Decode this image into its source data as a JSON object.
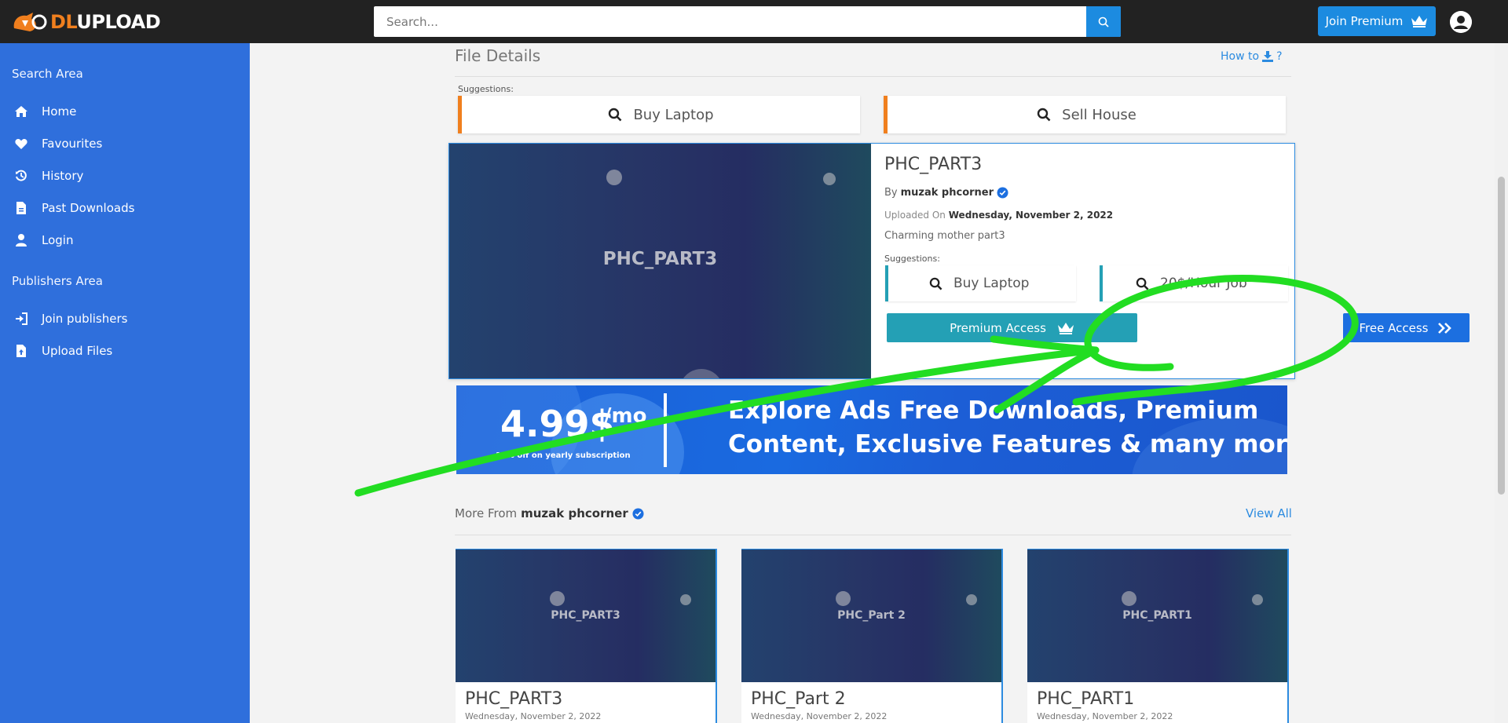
{
  "header": {
    "logo_dl": "DL",
    "logo_upload": "UPLOAD",
    "search_placeholder": "Search...",
    "join_premium_label": "Join Premium"
  },
  "sidebar": {
    "search_area_label": "Search Area",
    "search_items": [
      {
        "label": "Home",
        "icon": "home-icon"
      },
      {
        "label": "Favourites",
        "icon": "heart-icon"
      },
      {
        "label": "History",
        "icon": "history-icon"
      },
      {
        "label": "Past Downloads",
        "icon": "file-icon"
      },
      {
        "label": "Login",
        "icon": "user-icon"
      }
    ],
    "publishers_area_label": "Publishers Area",
    "publisher_items": [
      {
        "label": "Join publishers",
        "icon": "sign-in-icon"
      },
      {
        "label": "Upload Files",
        "icon": "file-upload-icon"
      }
    ]
  },
  "file_details": {
    "heading": "File Details",
    "how_to_label": "How to",
    "how_to_suffix": "?",
    "suggestions_label": "Suggestions:",
    "top_suggestions": [
      "Buy Laptop",
      "Sell House"
    ]
  },
  "file": {
    "thumb_title": "PHC_PART3",
    "title": "PHC_PART3",
    "by_prefix": "By",
    "author": "muzak phcorner",
    "uploaded_prefix": "Uploaded On",
    "uploaded_date": "Wednesday, November 2, 2022",
    "description": "Charming mother part3",
    "suggestions_label": "Suggestions:",
    "suggestions": [
      "Buy Laptop",
      "20$/Hour Job"
    ],
    "premium_access_label": "Premium Access",
    "free_access_label": "Free Access"
  },
  "banner": {
    "price": "4.99$",
    "per": "/mo",
    "sub": "11% off on yearly subscription",
    "line1": "Explore Ads Free Downloads, Premium",
    "line2": "Content, Exclusive Features & many more!"
  },
  "more_from": {
    "prefix": "More From",
    "author": "muzak phcorner",
    "view_all_label": "View All",
    "files": [
      {
        "thumb_title": "PHC_PART3",
        "title": "PHC_PART3",
        "date": "Wednesday, November 2, 2022"
      },
      {
        "thumb_title": "PHC_Part 2",
        "title": "PHC_Part 2",
        "date": "Wednesday, November 2, 2022"
      },
      {
        "thumb_title": "PHC_PART1",
        "title": "PHC_PART1",
        "date": "Wednesday, November 2, 2022"
      }
    ]
  },
  "colors": {
    "sidebar": "#2f6fdc",
    "topbar": "#222222",
    "accent_blue": "#1c8be0",
    "accent_orange": "#f07f1e",
    "premium_teal": "#24a0b5",
    "annotation_green": "#22dd22"
  }
}
